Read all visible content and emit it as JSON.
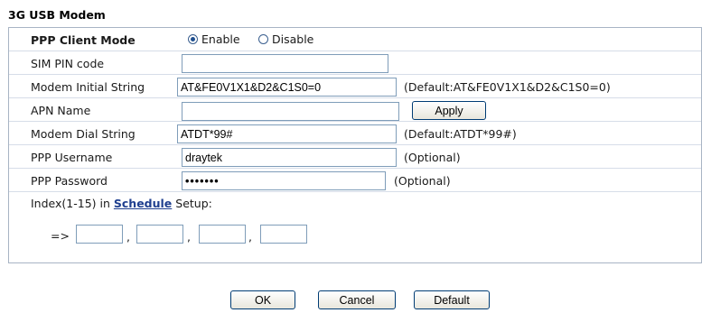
{
  "section_title": "3G USB Modem",
  "ppp_client_mode": {
    "label": "PPP Client Mode",
    "options": [
      "Enable",
      "Disable"
    ],
    "selected": "Enable"
  },
  "sim_pin": {
    "label": "SIM PIN code",
    "value": ""
  },
  "modem_init": {
    "label": "Modem Initial String",
    "value": "AT&FE0V1X1&D2&C1S0=0",
    "note": "(Default:AT&FE0V1X1&D2&C1S0=0)"
  },
  "apn": {
    "label": "APN Name",
    "value": "",
    "apply_label": "Apply"
  },
  "dial": {
    "label": "Modem Dial String",
    "value": "ATDT*99#",
    "note": "(Default:ATDT*99#)"
  },
  "username": {
    "label": "PPP Username",
    "value": "draytek",
    "note": "(Optional)"
  },
  "password": {
    "label": "PPP Password",
    "value": "•••••••",
    "note": "(Optional)"
  },
  "schedule": {
    "prefix": "Index(1-15) in",
    "link": "Schedule",
    "suffix": "Setup:",
    "arrow": "=>",
    "sep": ","
  },
  "buttons": {
    "ok": "OK",
    "cancel": "Cancel",
    "default": "Default"
  }
}
